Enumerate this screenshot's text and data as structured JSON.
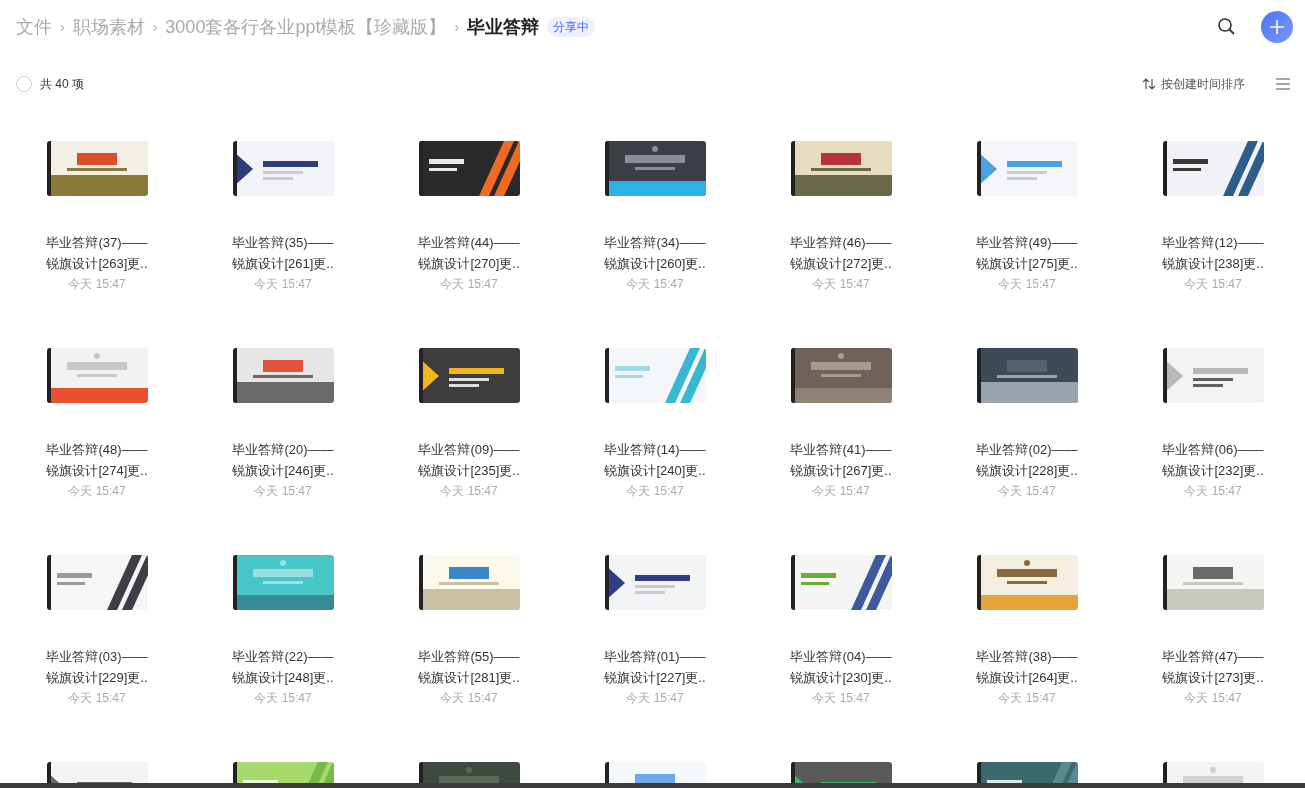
{
  "breadcrumb": [
    {
      "label": "文件",
      "current": false
    },
    {
      "separator": "›",
      "label": "职场素材",
      "current": false
    },
    {
      "separator": "›",
      "label": "3000套各行各业ppt模板【珍藏版】",
      "current": false
    },
    {
      "separator": "›",
      "label": "毕业答辩",
      "current": true
    }
  ],
  "share_badge": "分享中",
  "toolbar": {
    "select_all_checked": false,
    "count": "共 40 项",
    "sort": "按创建时间排序"
  },
  "items": [
    {
      "kind": "picture",
      "name_lines": [
        "毕业答辩(37)——",
        "锐旗设计[263]更.."
      ],
      "time": "今天 15:47"
    },
    {
      "kind": "picture",
      "name_lines": [
        "毕业答辩(35)——",
        "锐旗设计[261]更.."
      ],
      "time": "今天 15:47"
    },
    {
      "kind": "picture",
      "name_lines": [
        "毕业答辩(44)——",
        "锐旗设计[270]更.."
      ],
      "time": "今天 15:47"
    },
    {
      "kind": "picture",
      "name_lines": [
        "毕业答辩(34)——",
        "锐旗设计[260]更.."
      ],
      "time": "今天 15:47"
    },
    {
      "kind": "picture",
      "name_lines": [
        "毕业答辩(46)——",
        "锐旗设计[272]更.."
      ],
      "time": "今天 15:47"
    },
    {
      "kind": "picture",
      "name_lines": [
        "毕业答辩(49)——",
        "锐旗设计[275]更.."
      ],
      "time": "今天 15:47"
    },
    {
      "kind": "picture",
      "name_lines": [
        "毕业答辩(12)——",
        "锐旗设计[238]更.."
      ],
      "time": "今天 15:47"
    },
    {
      "kind": "picture",
      "name_lines": [
        "毕业答辩(48)——",
        "锐旗设计[274]更.."
      ],
      "time": "今天 15:47"
    },
    {
      "kind": "picture",
      "name_lines": [
        "毕业答辩(20)——",
        "锐旗设计[246]更.."
      ],
      "time": "今天 15:47"
    },
    {
      "kind": "picture",
      "name_lines": [
        "毕业答辩(09)——",
        "锐旗设计[235]更.."
      ],
      "time": "今天 15:47"
    },
    {
      "kind": "picture",
      "name_lines": [
        "毕业答辩(14)——",
        "锐旗设计[240]更.."
      ],
      "time": "今天 15:47"
    },
    {
      "kind": "picture",
      "name_lines": [
        "毕业答辩(41)——",
        "锐旗设计[267]更.."
      ],
      "time": "今天 15:47"
    },
    {
      "kind": "picture",
      "name_lines": [
        "毕业答辩(02)——",
        "锐旗设计[228]更.."
      ],
      "time": "今天 15:47"
    },
    {
      "kind": "picture",
      "name_lines": [
        "毕业答辩(06)——",
        "锐旗设计[232]更.."
      ],
      "time": "今天 15:47"
    },
    {
      "kind": "picture",
      "name_lines": [
        "毕业答辩(03)——",
        "锐旗设计[229]更.."
      ],
      "time": "今天 15:47"
    },
    {
      "kind": "picture",
      "name_lines": [
        "毕业答辩(22)——",
        "锐旗设计[248]更.."
      ],
      "time": "今天 15:47"
    },
    {
      "kind": "picture",
      "name_lines": [
        "毕业答辩(55)——",
        "锐旗设计[281]更.."
      ],
      "time": "今天 15:47"
    },
    {
      "kind": "picture",
      "name_lines": [
        "毕业答辩(01)——",
        "锐旗设计[227]更.."
      ],
      "time": "今天 15:47"
    },
    {
      "kind": "picture",
      "name_lines": [
        "毕业答辩(04)——",
        "锐旗设计[230]更.."
      ],
      "time": "今天 15:47"
    },
    {
      "kind": "picture",
      "name_lines": [
        "毕业答辩(38)——",
        "锐旗设计[264]更.."
      ],
      "time": "今天 15:47"
    },
    {
      "kind": "picture",
      "name_lines": [
        "毕业答辩(47)——",
        "锐旗设计[273]更.."
      ],
      "time": "今天 15:47"
    },
    {
      "kind": "picture"
    },
    {
      "kind": "picture"
    },
    {
      "kind": "picture"
    },
    {
      "kind": "picture"
    },
    {
      "kind": "picture"
    },
    {
      "kind": "picture"
    },
    {
      "kind": "picture"
    }
  ]
}
